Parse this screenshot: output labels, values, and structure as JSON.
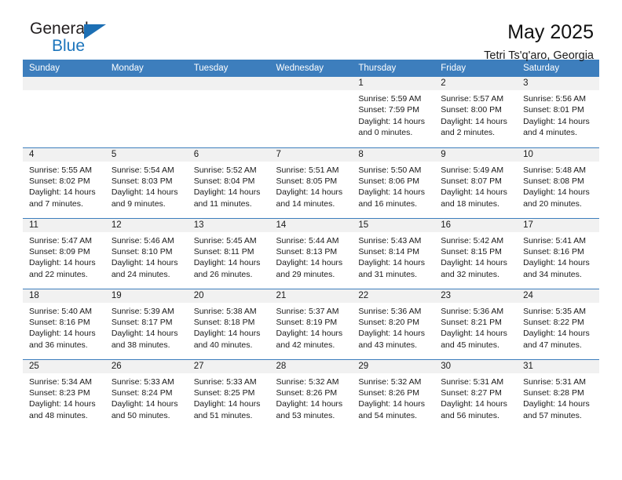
{
  "brand": {
    "name_top": "General",
    "name_bottom": "Blue",
    "triangle_color": "#1c6fb4",
    "blue_color": "#1c75bc"
  },
  "header": {
    "title": "May 2025",
    "subtitle": "Tetri Ts'q'aro, Georgia"
  },
  "theme": {
    "header_row_bg": "#3d7ebd",
    "daynum_band_bg": "#f1f1f1",
    "row_separator": "#3d7ebd",
    "text": "#1a1a1a"
  },
  "weekdays": [
    "Sunday",
    "Monday",
    "Tuesday",
    "Wednesday",
    "Thursday",
    "Friday",
    "Saturday"
  ],
  "weeks": [
    [
      {
        "day": "",
        "sunrise": "",
        "sunset": "",
        "daylight_line1": "",
        "daylight_line2": ""
      },
      {
        "day": "",
        "sunrise": "",
        "sunset": "",
        "daylight_line1": "",
        "daylight_line2": ""
      },
      {
        "day": "",
        "sunrise": "",
        "sunset": "",
        "daylight_line1": "",
        "daylight_line2": ""
      },
      {
        "day": "",
        "sunrise": "",
        "sunset": "",
        "daylight_line1": "",
        "daylight_line2": ""
      },
      {
        "day": "1",
        "sunrise": "Sunrise: 5:59 AM",
        "sunset": "Sunset: 7:59 PM",
        "daylight_line1": "Daylight: 14 hours",
        "daylight_line2": "and 0 minutes."
      },
      {
        "day": "2",
        "sunrise": "Sunrise: 5:57 AM",
        "sunset": "Sunset: 8:00 PM",
        "daylight_line1": "Daylight: 14 hours",
        "daylight_line2": "and 2 minutes."
      },
      {
        "day": "3",
        "sunrise": "Sunrise: 5:56 AM",
        "sunset": "Sunset: 8:01 PM",
        "daylight_line1": "Daylight: 14 hours",
        "daylight_line2": "and 4 minutes."
      }
    ],
    [
      {
        "day": "4",
        "sunrise": "Sunrise: 5:55 AM",
        "sunset": "Sunset: 8:02 PM",
        "daylight_line1": "Daylight: 14 hours",
        "daylight_line2": "and 7 minutes."
      },
      {
        "day": "5",
        "sunrise": "Sunrise: 5:54 AM",
        "sunset": "Sunset: 8:03 PM",
        "daylight_line1": "Daylight: 14 hours",
        "daylight_line2": "and 9 minutes."
      },
      {
        "day": "6",
        "sunrise": "Sunrise: 5:52 AM",
        "sunset": "Sunset: 8:04 PM",
        "daylight_line1": "Daylight: 14 hours",
        "daylight_line2": "and 11 minutes."
      },
      {
        "day": "7",
        "sunrise": "Sunrise: 5:51 AM",
        "sunset": "Sunset: 8:05 PM",
        "daylight_line1": "Daylight: 14 hours",
        "daylight_line2": "and 14 minutes."
      },
      {
        "day": "8",
        "sunrise": "Sunrise: 5:50 AM",
        "sunset": "Sunset: 8:06 PM",
        "daylight_line1": "Daylight: 14 hours",
        "daylight_line2": "and 16 minutes."
      },
      {
        "day": "9",
        "sunrise": "Sunrise: 5:49 AM",
        "sunset": "Sunset: 8:07 PM",
        "daylight_line1": "Daylight: 14 hours",
        "daylight_line2": "and 18 minutes."
      },
      {
        "day": "10",
        "sunrise": "Sunrise: 5:48 AM",
        "sunset": "Sunset: 8:08 PM",
        "daylight_line1": "Daylight: 14 hours",
        "daylight_line2": "and 20 minutes."
      }
    ],
    [
      {
        "day": "11",
        "sunrise": "Sunrise: 5:47 AM",
        "sunset": "Sunset: 8:09 PM",
        "daylight_line1": "Daylight: 14 hours",
        "daylight_line2": "and 22 minutes."
      },
      {
        "day": "12",
        "sunrise": "Sunrise: 5:46 AM",
        "sunset": "Sunset: 8:10 PM",
        "daylight_line1": "Daylight: 14 hours",
        "daylight_line2": "and 24 minutes."
      },
      {
        "day": "13",
        "sunrise": "Sunrise: 5:45 AM",
        "sunset": "Sunset: 8:11 PM",
        "daylight_line1": "Daylight: 14 hours",
        "daylight_line2": "and 26 minutes."
      },
      {
        "day": "14",
        "sunrise": "Sunrise: 5:44 AM",
        "sunset": "Sunset: 8:13 PM",
        "daylight_line1": "Daylight: 14 hours",
        "daylight_line2": "and 29 minutes."
      },
      {
        "day": "15",
        "sunrise": "Sunrise: 5:43 AM",
        "sunset": "Sunset: 8:14 PM",
        "daylight_line1": "Daylight: 14 hours",
        "daylight_line2": "and 31 minutes."
      },
      {
        "day": "16",
        "sunrise": "Sunrise: 5:42 AM",
        "sunset": "Sunset: 8:15 PM",
        "daylight_line1": "Daylight: 14 hours",
        "daylight_line2": "and 32 minutes."
      },
      {
        "day": "17",
        "sunrise": "Sunrise: 5:41 AM",
        "sunset": "Sunset: 8:16 PM",
        "daylight_line1": "Daylight: 14 hours",
        "daylight_line2": "and 34 minutes."
      }
    ],
    [
      {
        "day": "18",
        "sunrise": "Sunrise: 5:40 AM",
        "sunset": "Sunset: 8:16 PM",
        "daylight_line1": "Daylight: 14 hours",
        "daylight_line2": "and 36 minutes."
      },
      {
        "day": "19",
        "sunrise": "Sunrise: 5:39 AM",
        "sunset": "Sunset: 8:17 PM",
        "daylight_line1": "Daylight: 14 hours",
        "daylight_line2": "and 38 minutes."
      },
      {
        "day": "20",
        "sunrise": "Sunrise: 5:38 AM",
        "sunset": "Sunset: 8:18 PM",
        "daylight_line1": "Daylight: 14 hours",
        "daylight_line2": "and 40 minutes."
      },
      {
        "day": "21",
        "sunrise": "Sunrise: 5:37 AM",
        "sunset": "Sunset: 8:19 PM",
        "daylight_line1": "Daylight: 14 hours",
        "daylight_line2": "and 42 minutes."
      },
      {
        "day": "22",
        "sunrise": "Sunrise: 5:36 AM",
        "sunset": "Sunset: 8:20 PM",
        "daylight_line1": "Daylight: 14 hours",
        "daylight_line2": "and 43 minutes."
      },
      {
        "day": "23",
        "sunrise": "Sunrise: 5:36 AM",
        "sunset": "Sunset: 8:21 PM",
        "daylight_line1": "Daylight: 14 hours",
        "daylight_line2": "and 45 minutes."
      },
      {
        "day": "24",
        "sunrise": "Sunrise: 5:35 AM",
        "sunset": "Sunset: 8:22 PM",
        "daylight_line1": "Daylight: 14 hours",
        "daylight_line2": "and 47 minutes."
      }
    ],
    [
      {
        "day": "25",
        "sunrise": "Sunrise: 5:34 AM",
        "sunset": "Sunset: 8:23 PM",
        "daylight_line1": "Daylight: 14 hours",
        "daylight_line2": "and 48 minutes."
      },
      {
        "day": "26",
        "sunrise": "Sunrise: 5:33 AM",
        "sunset": "Sunset: 8:24 PM",
        "daylight_line1": "Daylight: 14 hours",
        "daylight_line2": "and 50 minutes."
      },
      {
        "day": "27",
        "sunrise": "Sunrise: 5:33 AM",
        "sunset": "Sunset: 8:25 PM",
        "daylight_line1": "Daylight: 14 hours",
        "daylight_line2": "and 51 minutes."
      },
      {
        "day": "28",
        "sunrise": "Sunrise: 5:32 AM",
        "sunset": "Sunset: 8:26 PM",
        "daylight_line1": "Daylight: 14 hours",
        "daylight_line2": "and 53 minutes."
      },
      {
        "day": "29",
        "sunrise": "Sunrise: 5:32 AM",
        "sunset": "Sunset: 8:26 PM",
        "daylight_line1": "Daylight: 14 hours",
        "daylight_line2": "and 54 minutes."
      },
      {
        "day": "30",
        "sunrise": "Sunrise: 5:31 AM",
        "sunset": "Sunset: 8:27 PM",
        "daylight_line1": "Daylight: 14 hours",
        "daylight_line2": "and 56 minutes."
      },
      {
        "day": "31",
        "sunrise": "Sunrise: 5:31 AM",
        "sunset": "Sunset: 8:28 PM",
        "daylight_line1": "Daylight: 14 hours",
        "daylight_line2": "and 57 minutes."
      }
    ]
  ]
}
